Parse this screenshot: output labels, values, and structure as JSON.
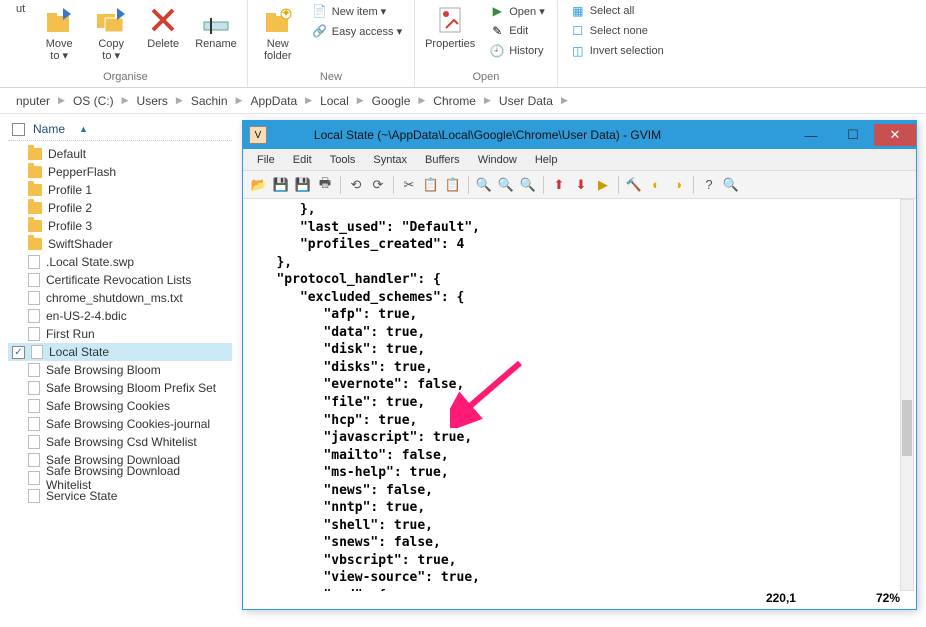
{
  "ribbon": {
    "cut": "ut",
    "moveTo": "Move\nto ▾",
    "copyTo": "Copy\nto ▾",
    "delete": "Delete",
    "rename": "Rename",
    "groupOrganise": "Organise",
    "newFolder": "New\nfolder",
    "newItem": "New item ▾",
    "easyAccess": "Easy access ▾",
    "groupNew": "New",
    "properties": "Properties",
    "open": "Open ▾",
    "edit": "Edit",
    "history": "History",
    "groupOpen": "Open",
    "selectAll": "Select all",
    "selectNone": "Select none",
    "invertSelection": "Invert selection"
  },
  "breadcrumb": [
    "nputer",
    "OS (C:)",
    "Users",
    "Sachin",
    "AppData",
    "Local",
    "Google",
    "Chrome",
    "User Data"
  ],
  "filelist": {
    "header": "Name",
    "items": [
      {
        "name": "Default",
        "type": "folder"
      },
      {
        "name": "PepperFlash",
        "type": "folder"
      },
      {
        "name": "Profile 1",
        "type": "folder"
      },
      {
        "name": "Profile 2",
        "type": "folder"
      },
      {
        "name": "Profile 3",
        "type": "folder"
      },
      {
        "name": "SwiftShader",
        "type": "folder"
      },
      {
        "name": ".Local State.swp",
        "type": "file"
      },
      {
        "name": "Certificate Revocation Lists",
        "type": "file"
      },
      {
        "name": "chrome_shutdown_ms.txt",
        "type": "file"
      },
      {
        "name": "en-US-2-4.bdic",
        "type": "file"
      },
      {
        "name": "First Run",
        "type": "file"
      },
      {
        "name": "Local State",
        "type": "file",
        "selected": true,
        "checked": true
      },
      {
        "name": "Safe Browsing Bloom",
        "type": "file"
      },
      {
        "name": "Safe Browsing Bloom Prefix Set",
        "type": "file"
      },
      {
        "name": "Safe Browsing Cookies",
        "type": "file"
      },
      {
        "name": "Safe Browsing Cookies-journal",
        "type": "file"
      },
      {
        "name": "Safe Browsing Csd Whitelist",
        "type": "file"
      },
      {
        "name": "Safe Browsing Download",
        "type": "file"
      },
      {
        "name": "Safe Browsing Download Whitelist",
        "type": "file"
      },
      {
        "name": "Service State",
        "type": "file"
      }
    ]
  },
  "gvim": {
    "title": "Local State (~\\AppData\\Local\\Google\\Chrome\\User Data) - GVIM",
    "menus": [
      "File",
      "Edit",
      "Tools",
      "Syntax",
      "Buffers",
      "Window",
      "Help"
    ],
    "content": "      },\n      \"last_used\": \"Default\",\n      \"profiles_created\": 4\n   },\n   \"protocol_handler\": {\n      \"excluded_schemes\": {\n         \"afp\": true,\n         \"data\": true,\n         \"disk\": true,\n         \"disks\": true,\n         \"evernote\": false,\n         \"file\": true,\n         \"hcp\": true,\n         \"javascript\": true,\n         \"mailto\": false,\n         \"ms-help\": true,\n         \"news\": false,\n         \"nntp\": true,\n         \"shell\": true,\n         \"snews\": false,\n         \"vbscript\": true,\n         \"view-source\": true,\n         \"vnd\": {\n            \"ms\": {",
    "statusPos": "220,1",
    "statusPct": "72%"
  }
}
